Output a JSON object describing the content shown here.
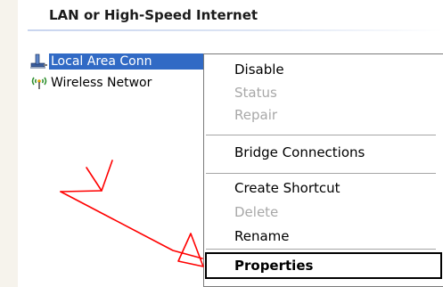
{
  "group": {
    "header": "LAN or High-Speed Internet"
  },
  "connections": [
    {
      "label": "Local Area Conn",
      "icon": "network-cable-icon",
      "selected": true
    },
    {
      "label": "Wireless Networ",
      "icon": "wireless-signal-icon",
      "selected": false
    }
  ],
  "context_menu": {
    "items": [
      {
        "label": "Disable",
        "enabled": true
      },
      {
        "label": "Status",
        "enabled": false
      },
      {
        "label": "Repair",
        "enabled": false
      },
      {
        "label": "Bridge Connections",
        "enabled": true
      },
      {
        "label": "Create Shortcut",
        "enabled": true
      },
      {
        "label": "Delete",
        "enabled": false
      },
      {
        "label": "Rename",
        "enabled": true
      },
      {
        "label": "Properties",
        "enabled": true,
        "default": true,
        "highlighted_by_box": true
      }
    ]
  },
  "annotation": {
    "type": "hand-drawn arrow",
    "points_to": "Properties",
    "color": "#ff0000"
  },
  "colors": {
    "selection_bg": "#316ac5",
    "selection_text": "#ffffff",
    "disabled_text": "#a8a8a8",
    "annotation_red": "#ff0000"
  }
}
